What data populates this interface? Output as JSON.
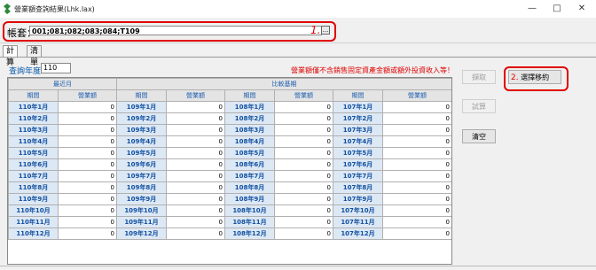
{
  "window": {
    "title": "營業額查詢結果(Lhk.lax)",
    "minimize": "—",
    "maximize": "□",
    "close": "✕"
  },
  "account": {
    "label": "帳套：",
    "value": "001;081;082;083;084;T109",
    "step_marker": "1.",
    "browse": "..."
  },
  "tabs": [
    {
      "label": "計算",
      "active": true
    },
    {
      "label": "清單",
      "active": false
    }
  ],
  "query": {
    "year_label": "查詢年度",
    "year_value": "110"
  },
  "notice": "營業額僅不含銷售固定資產金額或額外投資收入等！",
  "table": {
    "group_headers": [
      "最近月",
      "比較基期"
    ],
    "columns": [
      "期間",
      "營業額",
      "期間",
      "營業額",
      "期間",
      "營業額",
      "期間",
      "營業額"
    ],
    "rows": [
      [
        "110年1月",
        "0",
        "109年1月",
        "0",
        "108年1月",
        "0",
        "107年1月",
        "0"
      ],
      [
        "110年2月",
        "0",
        "109年2月",
        "0",
        "108年2月",
        "0",
        "107年2月",
        "0"
      ],
      [
        "110年3月",
        "0",
        "109年3月",
        "0",
        "108年3月",
        "0",
        "107年3月",
        "0"
      ],
      [
        "110年4月",
        "0",
        "109年4月",
        "0",
        "108年4月",
        "0",
        "107年4月",
        "0"
      ],
      [
        "110年5月",
        "0",
        "109年5月",
        "0",
        "108年5月",
        "0",
        "107年5月",
        "0"
      ],
      [
        "110年6月",
        "0",
        "109年6月",
        "0",
        "108年6月",
        "0",
        "107年6月",
        "0"
      ],
      [
        "110年7月",
        "0",
        "109年7月",
        "0",
        "108年7月",
        "0",
        "107年7月",
        "0"
      ],
      [
        "110年8月",
        "0",
        "109年8月",
        "0",
        "108年8月",
        "0",
        "107年8月",
        "0"
      ],
      [
        "110年9月",
        "0",
        "109年9月",
        "0",
        "108年9月",
        "0",
        "107年9月",
        "0"
      ],
      [
        "110年10月",
        "0",
        "109年10月",
        "0",
        "108年10月",
        "0",
        "107年10月",
        "0"
      ],
      [
        "110年11月",
        "0",
        "109年11月",
        "0",
        "108年11月",
        "0",
        "107年11月",
        "0"
      ],
      [
        "110年12月",
        "0",
        "109年12月",
        "0",
        "108年12月",
        "0",
        "107年12月",
        "0"
      ]
    ]
  },
  "buttons": {
    "fetch": "擷取",
    "compare_step": "2.",
    "compare": "選擇移約",
    "calc": "試算",
    "clear": "清空"
  },
  "colors": {
    "highlight_red": "#e00000",
    "header_blue": "#2060b0",
    "period_bg": "#dde8f5"
  }
}
